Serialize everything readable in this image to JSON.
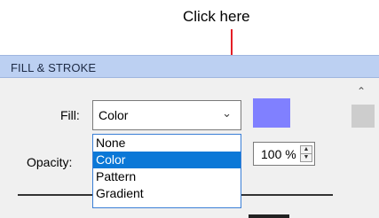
{
  "annotation": {
    "text": "Click here"
  },
  "panel": {
    "title": "FILL & STROKE"
  },
  "fill": {
    "label": "Fill:",
    "selected": "Color",
    "options": [
      "None",
      "Color",
      "Pattern",
      "Gradient"
    ],
    "highlighted_option": "Color",
    "swatch_color": "#8080ff"
  },
  "opacity": {
    "label": "Opacity:",
    "value": "100 %"
  },
  "icons": {
    "select_chevron": "chevron-down-icon",
    "scroll_up": "scroll-up-icon",
    "spin_up": "spin-up-icon",
    "spin_down": "spin-down-icon"
  }
}
